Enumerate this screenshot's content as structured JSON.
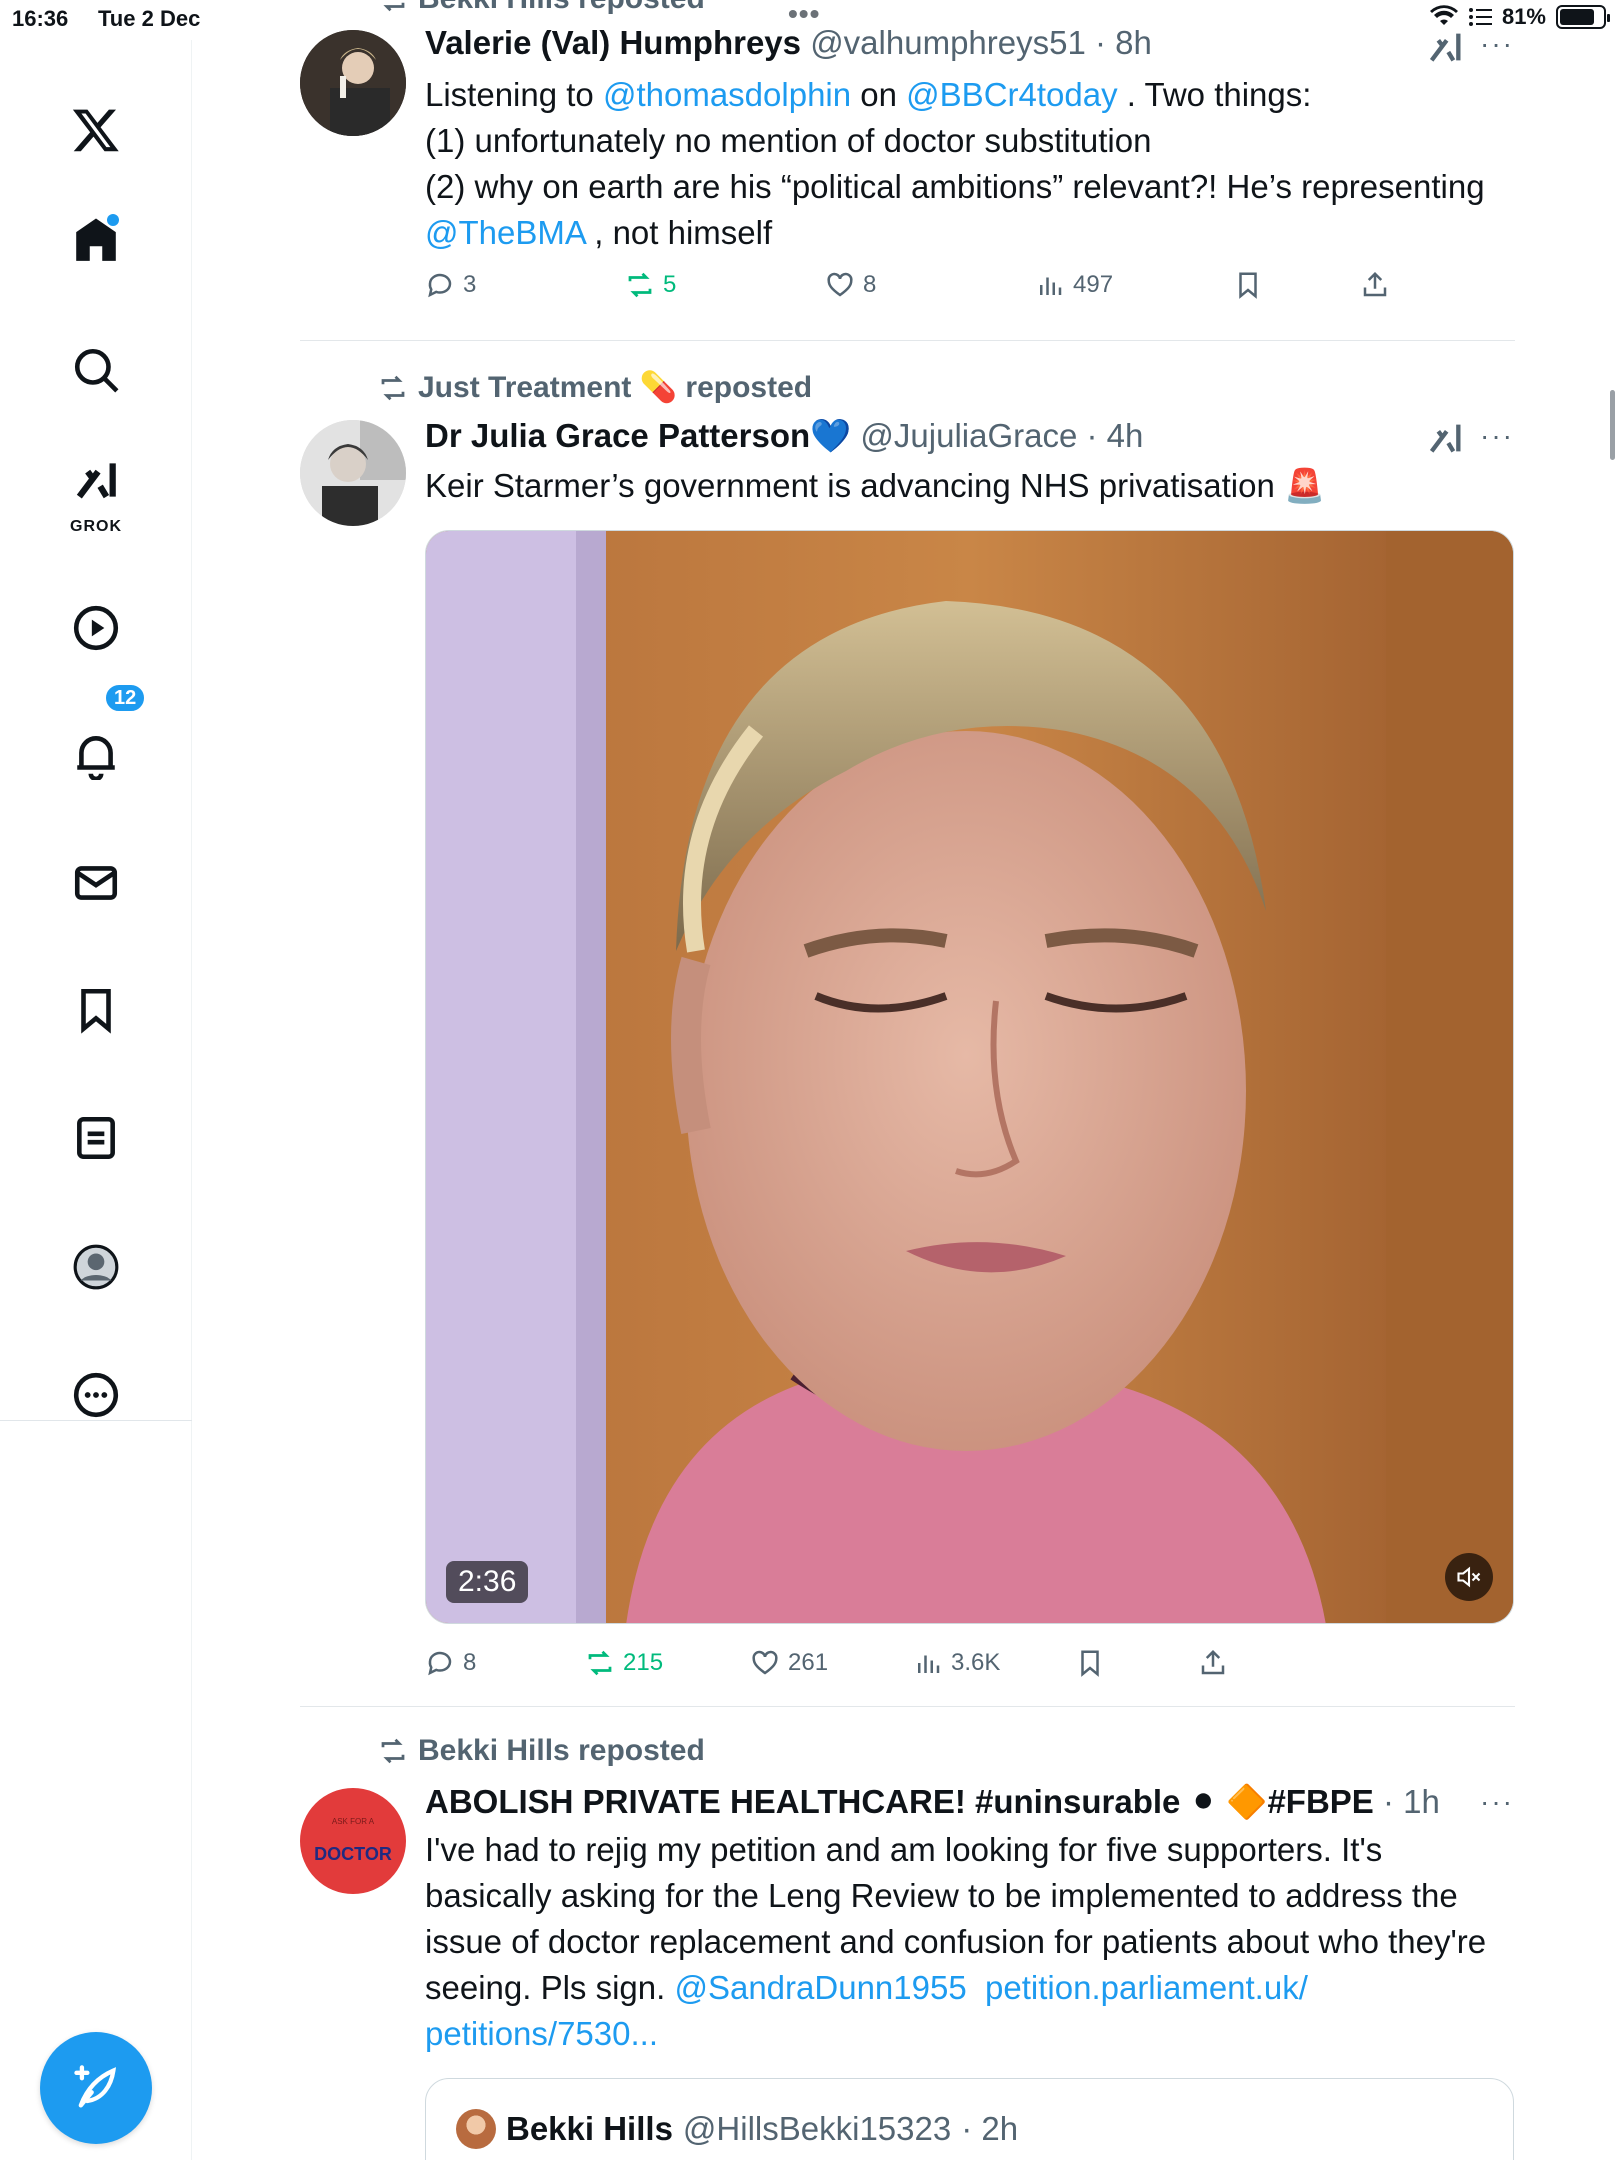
{
  "status_bar": {
    "time": "16:36",
    "date": "Tue 2 Dec",
    "battery": "81%",
    "battery_level": 0.81
  },
  "sidebar": {
    "notifications_badge": "12",
    "grok_label": "GROK",
    "items": [
      "x-logo",
      "home-icon",
      "search-icon",
      "grok-icon",
      "video-icon",
      "bell-icon",
      "mail-icon",
      "bookmark-icon",
      "lists-icon",
      "profile-icon",
      "more-icon"
    ]
  },
  "tweets": [
    {
      "repost_text": "Bekki Hills reposted",
      "name": "Valerie (Val) Humphreys",
      "handle": "@valhumphreys51",
      "time": "· 8h",
      "text_parts": [
        "Listening to ",
        "@thomasdolphin",
        " on ",
        "@BBCr4today",
        " . Two things:",
        "(1) unfortunately no mention of doctor substitution",
        "(2) why on earth are his “political ambitions” relevant?! He’s representing ",
        "@TheBMA",
        " , not himself"
      ],
      "replies": "3",
      "reposts": "5",
      "likes": "8",
      "views": "497"
    },
    {
      "repost_text": "Just Treatment 💊 reposted",
      "name": "Dr Julia Grace Patterson💙",
      "handle": "@JujuliaGrace",
      "time": "· 4h",
      "text": "Keir Starmer’s government is advancing NHS privatisation 🚨",
      "video_duration": "2:36",
      "replies": "8",
      "reposts": "215",
      "likes": "261",
      "views": "3.6K"
    },
    {
      "repost_text": "Bekki Hills reposted",
      "name": "ABOLISH PRIVATE HEALTHCARE! #uninsurable ⚫ 🔶#FBPE",
      "handle": "",
      "time": "· 1h",
      "avatar_small_text": "ASK FOR A",
      "avatar_text": "DOCTOR",
      "text_main": "I've had to rejig my petition and am looking for five supporters. It's basically asking for the Leng Review to be implemented to address the issue of doctor replacement and confusion for patients about who they're seeing. Pls sign. ",
      "link_mention": "@SandraDunn1955",
      "link_url_1": "petition.parliament.uk/",
      "link_url_2": "petitions/7530...",
      "quote": {
        "name": "Bekki Hills",
        "handle": "@HillsBekki15323",
        "time": "· 2h"
      }
    }
  ],
  "colors": {
    "accent": "#1d9bf0",
    "repost_green": "#00ba7c",
    "text": "#0f1419",
    "secondary": "#536471"
  }
}
